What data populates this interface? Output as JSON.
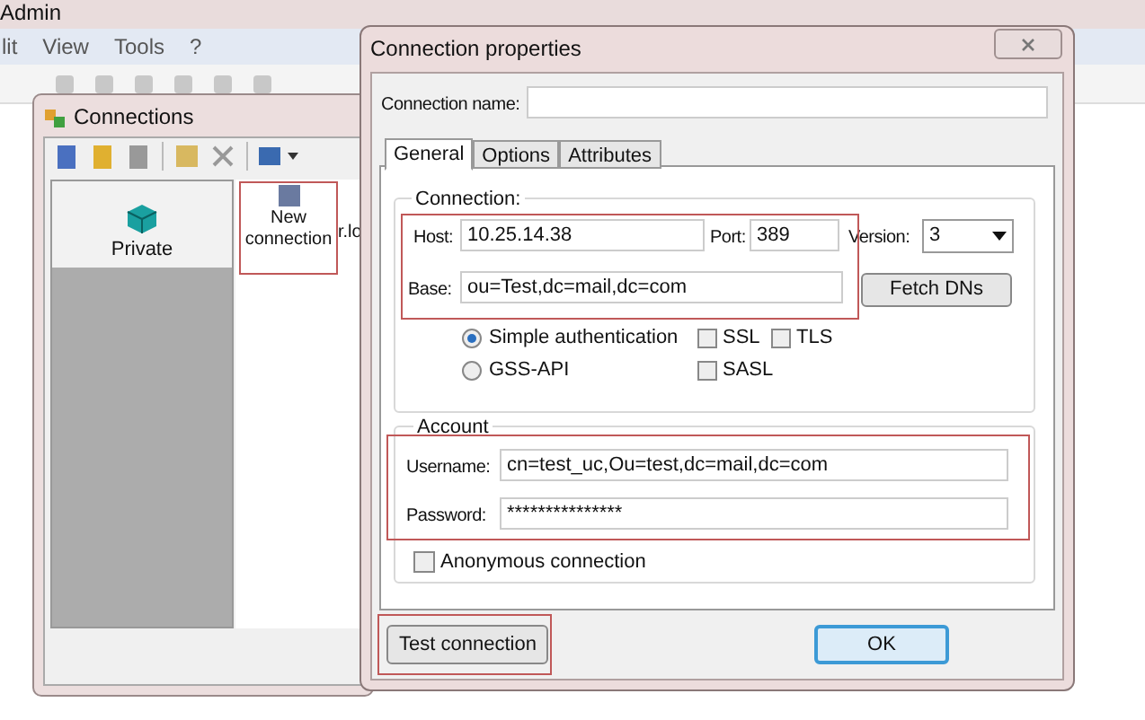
{
  "app": {
    "title": "Admin",
    "menu": [
      "lit",
      "View",
      "Tools",
      "?"
    ]
  },
  "connections_window": {
    "title": "Connections",
    "groups": [
      {
        "label": "Private"
      }
    ],
    "items": [
      {
        "label": "New connection"
      }
    ],
    "cut_label": "r.lo"
  },
  "dialog": {
    "title": "Connection properties",
    "connection_name_label": "Connection name:",
    "tabs": [
      {
        "label": "General",
        "selected": true
      },
      {
        "label": "Options",
        "selected": false
      },
      {
        "label": "Attributes",
        "selected": false
      }
    ],
    "connection": {
      "title": "Connection:",
      "host": {
        "label": "Host:",
        "value": "10.25.14.38"
      },
      "port": {
        "label": "Port:",
        "value": "389"
      },
      "version": {
        "label": "Version:",
        "value": "3"
      },
      "base": {
        "label": "Base:",
        "value": "ou=Test,dc=mail,dc=com"
      },
      "fetch_button": "Fetch DNs",
      "auth": [
        {
          "label": "Simple authentication",
          "selected": true
        },
        {
          "label": "GSS-API",
          "selected": false
        }
      ],
      "security": [
        {
          "label": "SSL",
          "checked": false
        },
        {
          "label": "TLS",
          "checked": false
        },
        {
          "label": "SASL",
          "checked": false
        }
      ]
    },
    "account": {
      "title": "Account",
      "username": {
        "label": "Username:",
        "value": "cn=test_uc,Ou=test,dc=mail,dc=com"
      },
      "password": {
        "label": "Password:",
        "value": "***************"
      },
      "anonymous": {
        "label": "Anonymous connection",
        "checked": false
      }
    },
    "buttons": [
      {
        "label": "Test connection",
        "default": false
      },
      {
        "label": "OK",
        "default": true
      }
    ]
  }
}
